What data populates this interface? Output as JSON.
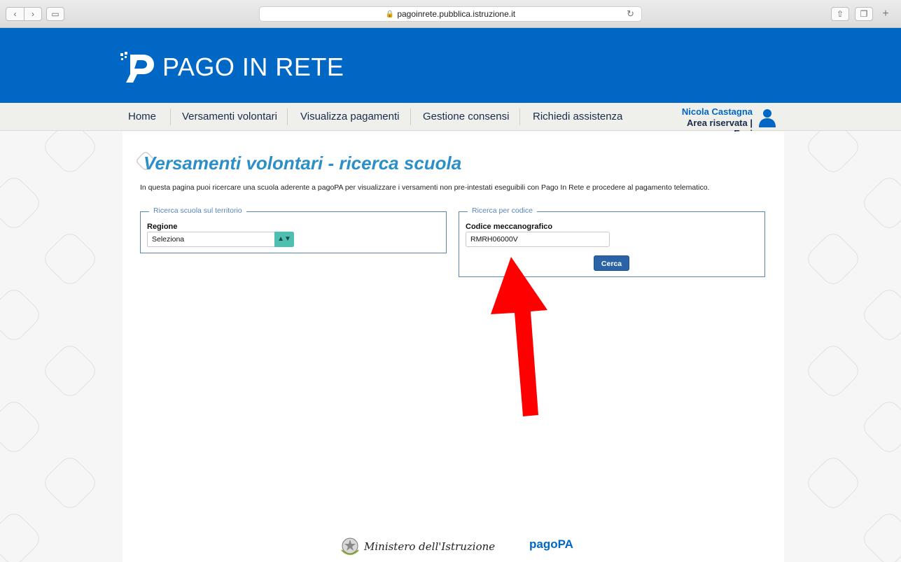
{
  "browser": {
    "url": "pagoinrete.pubblica.istruzione.it"
  },
  "header": {
    "logo_text": "PAGO IN RETE",
    "brand_color": "#0067c5"
  },
  "nav": {
    "items": [
      {
        "label": "Home"
      },
      {
        "label": "Versamenti volontari"
      },
      {
        "label": "Visualizza pagamenti"
      },
      {
        "label": "Gestione consensi"
      },
      {
        "label": "Richiedi assistenza"
      }
    ],
    "user_name": "Nicola Castagna",
    "user_area": "Area riservata",
    "user_logout": "Esci"
  },
  "main": {
    "title": "Versamenti volontari - ricerca scuola",
    "intro": "In questa pagina puoi ricercare una scuola aderente a pagoPA per visualizzare i versamenti non pre-intestati eseguibili con Pago In Rete e procedere al pagamento telematico.",
    "territory": {
      "legend": "Ricerca scuola sul territorio",
      "region_label": "Regione",
      "region_value": "Seleziona"
    },
    "code": {
      "legend": "Ricerca per codice",
      "code_label": "Codice meccanografico",
      "code_value": "RMRH06000V",
      "search_label": "Cerca"
    }
  },
  "footer": {
    "ministry": "Ministero dell'Istruzione",
    "pagopa": "pagoPA"
  }
}
